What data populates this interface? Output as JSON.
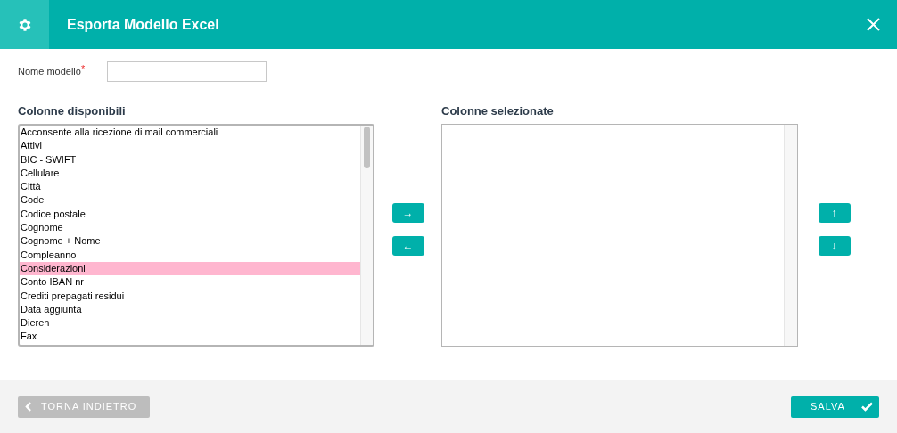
{
  "window": {
    "title": "Esporta Modello Excel"
  },
  "name_field": {
    "label": "Nome modello",
    "required_mark": "*"
  },
  "available": {
    "title": "Colonne disponibili",
    "items": [
      {
        "label": "Acconsente alla ricezione di mail commerciali",
        "selected": false
      },
      {
        "label": "Attivi",
        "selected": false
      },
      {
        "label": "BIC - SWIFT",
        "selected": false
      },
      {
        "label": "Cellulare",
        "selected": false
      },
      {
        "label": "Città",
        "selected": false
      },
      {
        "label": "Code",
        "selected": false
      },
      {
        "label": "Codice postale",
        "selected": false
      },
      {
        "label": "Cognome",
        "selected": false
      },
      {
        "label": "Cognome + Nome",
        "selected": false
      },
      {
        "label": "Compleanno",
        "selected": false
      },
      {
        "label": "Considerazioni",
        "selected": true
      },
      {
        "label": "Conto IBAN nr",
        "selected": false
      },
      {
        "label": "Crediti prepagati residui",
        "selected": false
      },
      {
        "label": "Data aggiunta",
        "selected": false
      },
      {
        "label": "Dieren",
        "selected": false
      },
      {
        "label": "Fax",
        "selected": false
      }
    ]
  },
  "transfer_buttons": [
    "→",
    "←"
  ],
  "selected_columns": {
    "title": "Colonne selezionate"
  },
  "order_buttons": [
    "↑",
    "↓"
  ],
  "footer": {
    "back": "TORNA INDIETRO",
    "save": "SALVA"
  }
}
